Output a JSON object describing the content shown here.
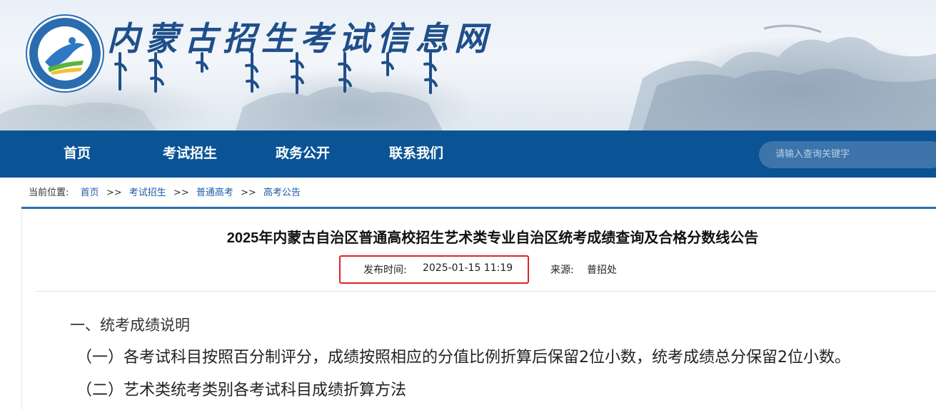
{
  "header": {
    "site_title": "内蒙古招生考试信息网"
  },
  "nav": {
    "items": [
      {
        "label": "首页"
      },
      {
        "label": "考试招生"
      },
      {
        "label": "政务公开"
      },
      {
        "label": "联系我们"
      }
    ],
    "search_placeholder": "请输入查询关键字"
  },
  "breadcrumb": {
    "prefix": "当前位置:",
    "items": [
      "首页",
      "考试招生",
      "普通高考",
      "高考公告"
    ],
    "separator": ">>"
  },
  "article": {
    "title": "2025年内蒙古自治区普通高校招生艺术类专业自治区统考成绩查询及合格分数线公告",
    "publish_label": "发布时间:",
    "publish_time": "2025-01-15 11:19",
    "source_label": "来源:",
    "source": "普招处",
    "section_heading": "一、统考成绩说明",
    "paragraphs": [
      "（一）各考试科目按照百分制评分，成绩按照相应的分值比例折算后保留2位小数，统考成绩总分保留2位小数。",
      "（二）艺术类统考类别各考试科目成绩折算方法"
    ]
  },
  "colors": {
    "nav_bg": "#0a5496",
    "highlight_border": "#e02424",
    "link": "#1d5aa8"
  }
}
